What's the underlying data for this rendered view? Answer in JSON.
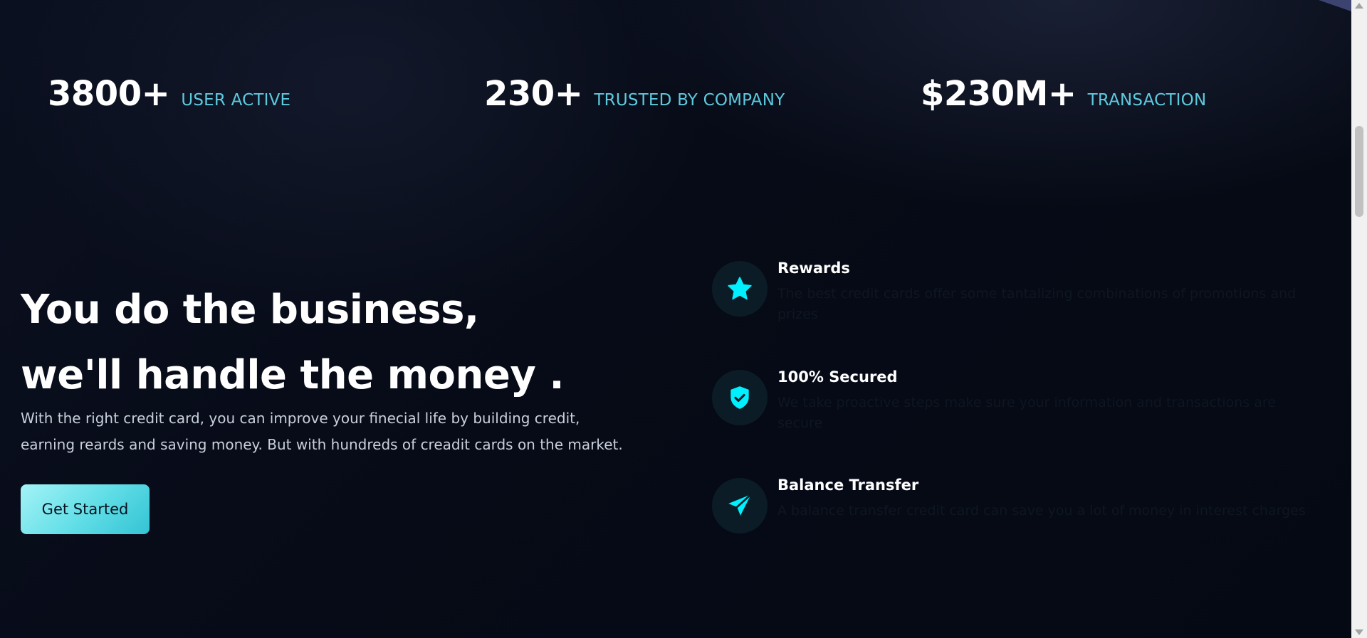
{
  "stats": [
    {
      "value": "3800+",
      "label": "USER ACTIVE"
    },
    {
      "value": "230+",
      "label": "TRUSTED BY COMPANY"
    },
    {
      "value": "$230M+",
      "label": "TRANSACTION"
    }
  ],
  "hero": {
    "title_line1": "You do the business,",
    "title_line2": "we'll handle the money .",
    "description": "With the right credit card, you can improve your finecial life by building credit, earning reards and saving money. But with hundreds of creadit cards on the market.",
    "cta_label": "Get Started"
  },
  "features": [
    {
      "icon": "star-icon",
      "title": "Rewards",
      "description": "The best credit cards offer some tantalizing combinations of promotions and prizes"
    },
    {
      "icon": "shield-check-icon",
      "title": "100% Secured",
      "description": "We take proactive steps make sure your information and transactions are secure"
    },
    {
      "icon": "paper-plane-icon",
      "title": "Balance Transfer",
      "description": "A balance transfer credit card can save you a lot of money in interest charges"
    }
  ],
  "colors": {
    "accent": "#00f0ff",
    "stat_label": "#5ec9dd",
    "background": "#060a16",
    "icon_circle": "#0b1c26"
  }
}
